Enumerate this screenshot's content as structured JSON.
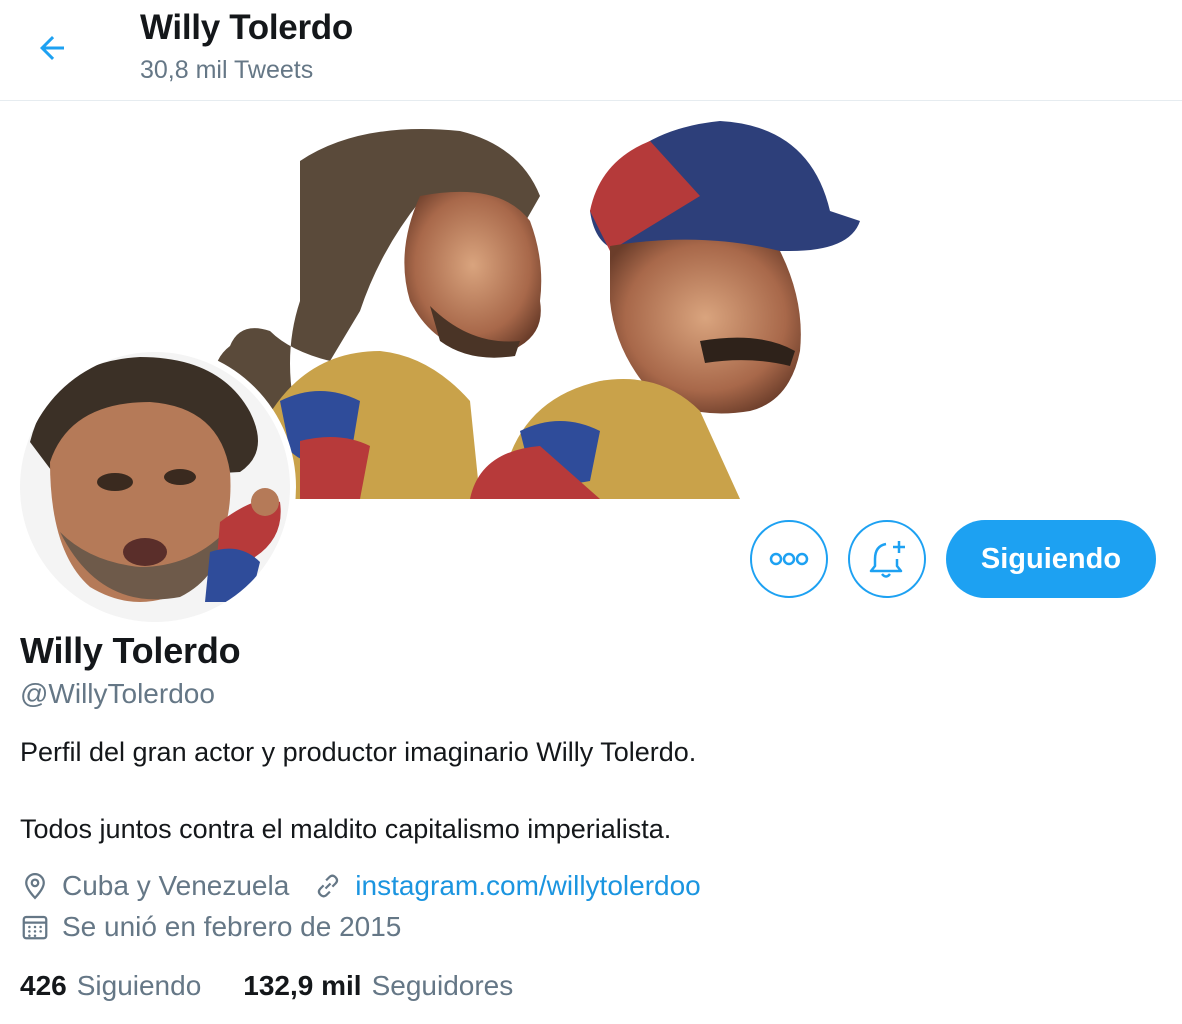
{
  "header": {
    "title": "Willy Tolerdo",
    "tweet_count": "30,8 mil Tweets"
  },
  "profile": {
    "name": "Willy Tolerdo",
    "handle": "@WillyTolerdoo",
    "bio_line1": "Perfil del gran actor y productor imaginario Willy Tolerdo.",
    "bio_line2": "Todos juntos contra el maldito capitalismo imperialista.",
    "location": "Cuba y Venezuela",
    "website": "instagram.com/willytolerdoo",
    "joined": "Se unió en febrero de 2015"
  },
  "actions": {
    "follow_label": "Siguiendo"
  },
  "stats": {
    "following_count": "426",
    "following_label": "Siguiendo",
    "followers_count": "132,9 mil",
    "followers_label": "Seguidores"
  },
  "colors": {
    "accent": "#1da1f2",
    "link": "#1b95e0",
    "muted": "#657786",
    "text": "#14171a"
  },
  "icons": [
    "back-arrow-icon",
    "more-icon",
    "bell-plus-icon",
    "location-pin-icon",
    "link-icon",
    "calendar-icon"
  ]
}
